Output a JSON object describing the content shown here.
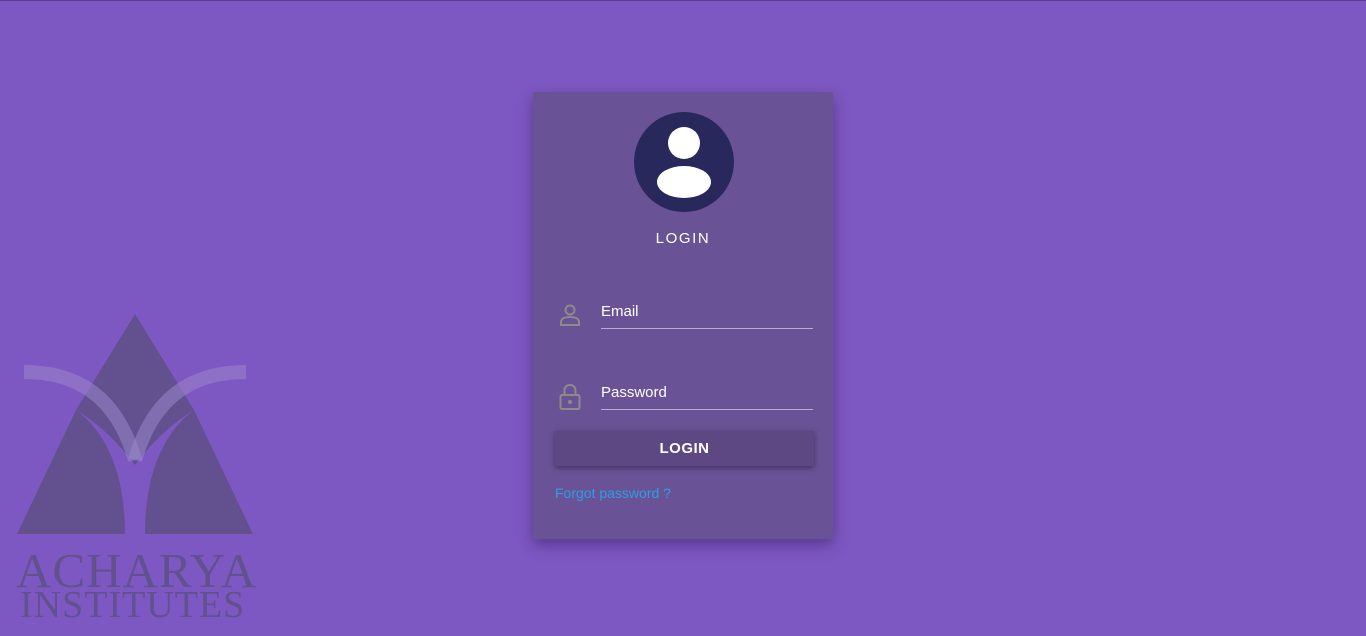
{
  "background": {
    "logo": {
      "line1": "ACHARYA",
      "line2": "INSTITUTES"
    }
  },
  "login": {
    "title": "LOGIN",
    "email": {
      "placeholder": "Email",
      "value": "",
      "icon": "user-outline-icon"
    },
    "password": {
      "placeholder": "Password",
      "value": "",
      "icon": "lock-icon"
    },
    "submit_label": "LOGIN",
    "forgot_label": "Forgot password ?"
  },
  "colors": {
    "page_background": "#7e58c2",
    "card_background": "#6a5296",
    "avatar_background": "#29285c",
    "button_background": "#5d4884",
    "link": "#2b9fe6"
  }
}
